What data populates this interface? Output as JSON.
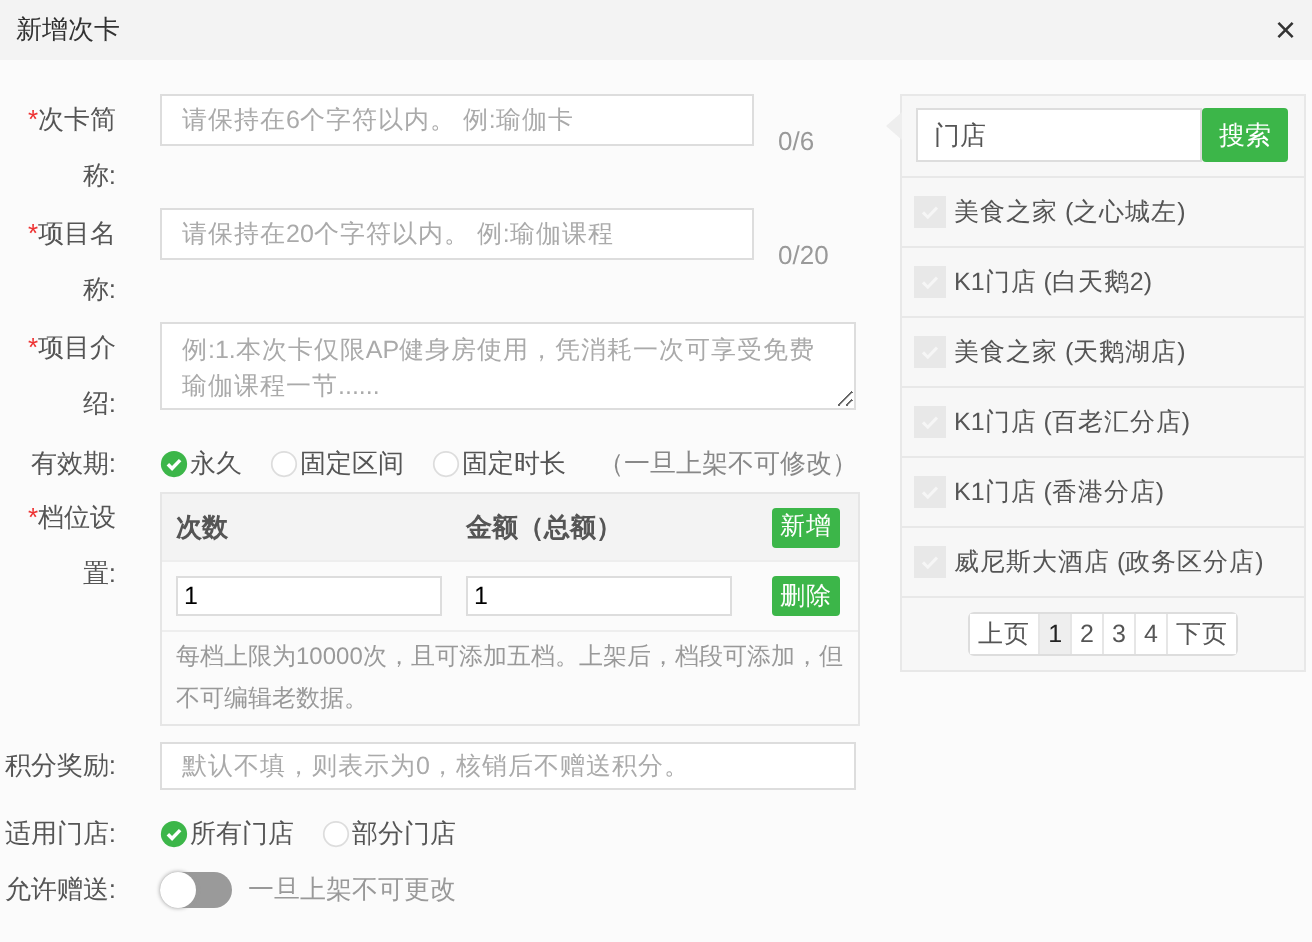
{
  "dialog": {
    "title": "新增次卡",
    "close": "×"
  },
  "fields": [
    {
      "kind": "text",
      "marker": "*",
      "label": "次卡简称:",
      "placeholder": "请保持在6个字符以内。 例:瑜伽卡",
      "counter": "0/6"
    },
    {
      "kind": "text",
      "marker": "*",
      "label": "项目名称:",
      "placeholder": "请保持在20个字符以内。 例:瑜伽课程",
      "counter": "0/20"
    },
    {
      "kind": "textarea",
      "marker": "*",
      "label": "项目介绍:",
      "placeholder": "例:1.本次卡仅限AP健身房使用，凭消耗一次可享受免费瑜伽课程一节......"
    },
    {
      "kind": "radio",
      "label": "有效期:",
      "options": [
        {
          "label": "永久",
          "selected": true
        },
        {
          "label": "固定区间",
          "selected": false
        },
        {
          "label": "固定时长",
          "selected": false
        }
      ],
      "note": "（一旦上架不可修改）"
    },
    {
      "kind": "tiers",
      "marker": "*",
      "label": "档位设置:",
      "columns": [
        "次数",
        "金额（总额）"
      ],
      "add_button": "新增",
      "rows": [
        {
          "values": [
            "1",
            "1"
          ],
          "delete_button": "删除"
        }
      ],
      "hint": "每档上限为10000次，且可添加五档。上架后，档段可添加，但不可编辑老数据。"
    },
    {
      "kind": "wide",
      "label": "积分奖励:",
      "placeholder": "默认不填，则表示为0，核销后不赠送积分。"
    },
    {
      "kind": "radio",
      "label": "适用门店:",
      "options": [
        {
          "label": "所有门店",
          "selected": true
        },
        {
          "label": "部分门店",
          "selected": false
        }
      ]
    },
    {
      "kind": "toggle",
      "label": "允许赠送:",
      "on": false,
      "note": "一旦上架不可更改"
    }
  ],
  "store_panel": {
    "search_value": "门店",
    "search_button": "搜索",
    "stores": [
      {
        "name": "美食之家 (之心城左)",
        "checked": false
      },
      {
        "name": "K1门店 (白天鹅2)",
        "checked": false
      },
      {
        "name": "美食之家 (天鹅湖店)",
        "checked": false
      },
      {
        "name": "K1门店 (百老汇分店)",
        "checked": false
      },
      {
        "name": "K1门店 (香港分店)",
        "checked": false
      },
      {
        "name": "威尼斯大酒店 (政务区分店)",
        "checked": false
      }
    ],
    "pages": [
      {
        "label": "上页",
        "selected": false
      },
      {
        "label": "1",
        "selected": true
      },
      {
        "label": "2",
        "selected": false
      },
      {
        "label": "3",
        "selected": false
      },
      {
        "label": "4",
        "selected": false
      },
      {
        "label": "下页",
        "selected": false
      }
    ]
  }
}
